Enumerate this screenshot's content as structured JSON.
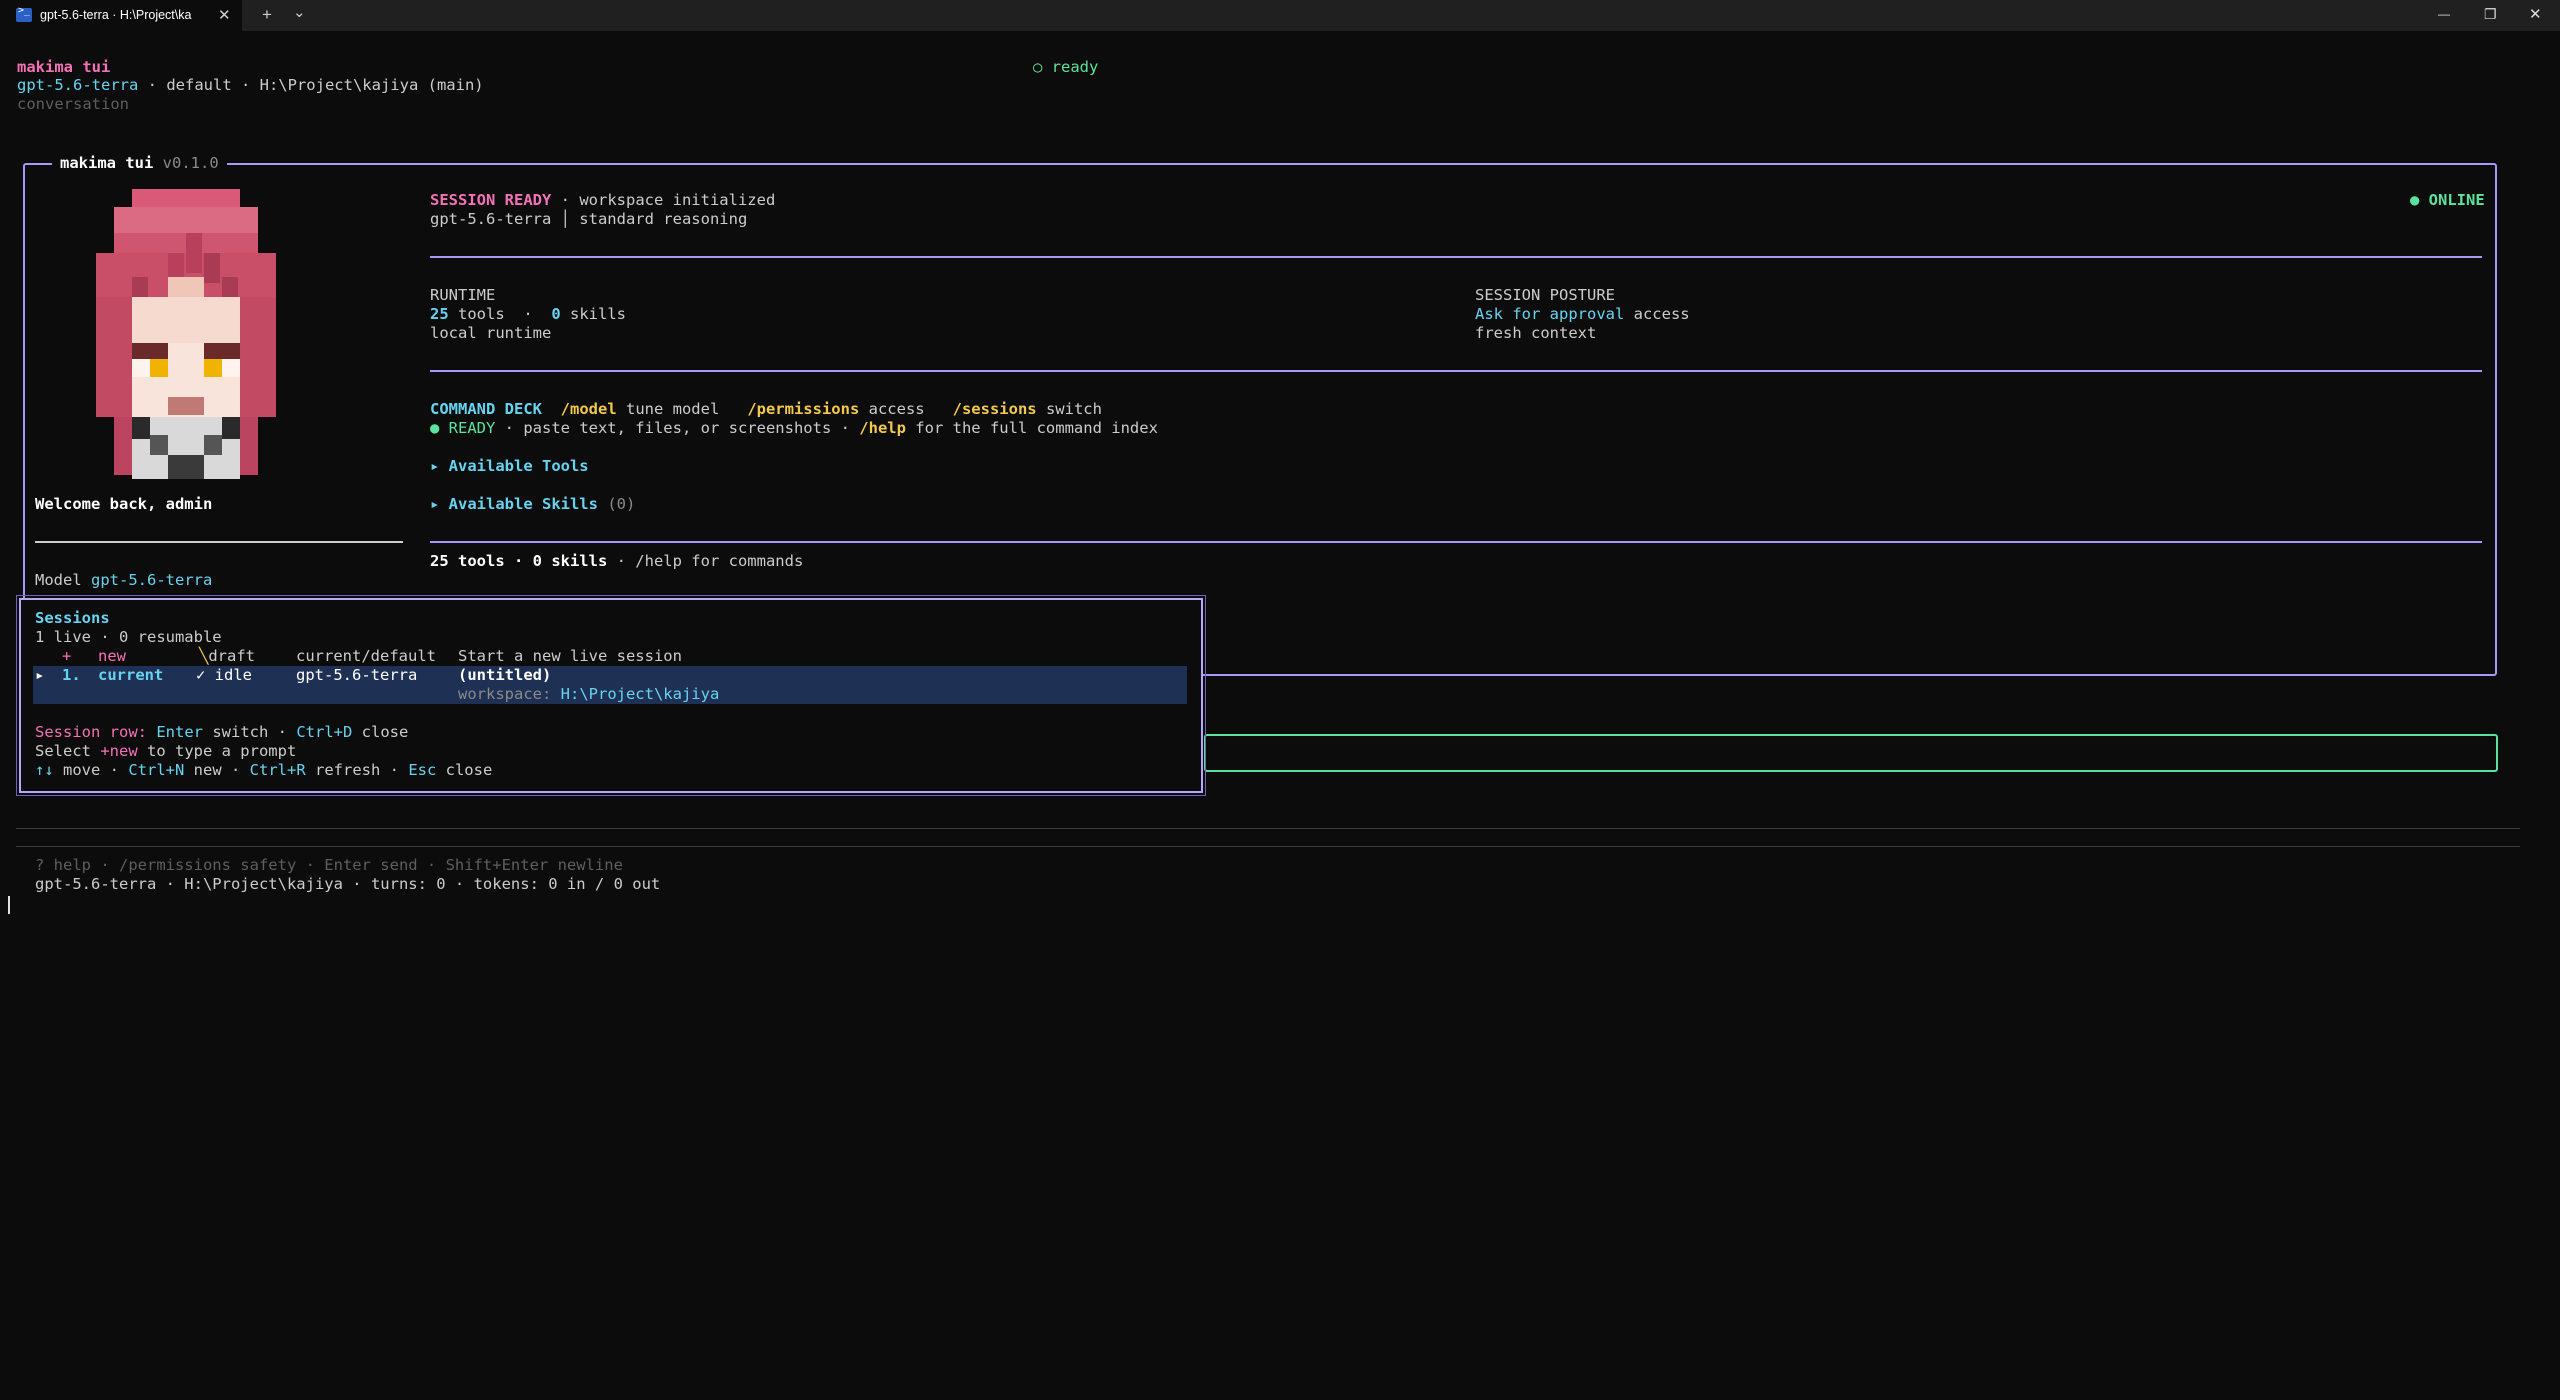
{
  "window": {
    "tab_title": "gpt-5.6-terra · H:\\Project\\ka",
    "tab_close": "✕",
    "new_tab": "+",
    "tab_dropdown": "⌄",
    "minimize": "—",
    "maximize": "❐",
    "close": "✕"
  },
  "header": {
    "app_name": "makima tui",
    "model": "gpt-5.6-terra",
    "profile_path": " · default · H:\\Project\\kajiya (main)",
    "view": "conversation",
    "status": "○ ready"
  },
  "banner": {
    "legend_name": "makima tui",
    "legend_version": "v0.1.0",
    "welcome": "Welcome back, admin",
    "model_label": "Model",
    "model_value": "gpt-5.6-terra",
    "session_ready": "SESSION READY",
    "workspace_text": " · workspace initialized",
    "model_line": "gpt-5.6-terra │ standard reasoning",
    "online": "● ONLINE",
    "runtime_title": "RUNTIME",
    "tools_count": "25",
    "tools_label": " tools  ·  ",
    "skills_count": "0",
    "skills_label": " skills",
    "runtime_mode": "local runtime",
    "posture_title": "SESSION POSTURE",
    "approval": "Ask for approval",
    "approval_suffix": " access",
    "context": "fresh context",
    "deck_title": "COMMAND DECK",
    "cmd_model": "/model",
    "cmd_model_desc": " tune model   ",
    "cmd_permissions": "/permissions",
    "cmd_permissions_desc": " access   ",
    "cmd_sessions": "/sessions",
    "cmd_sessions_desc": " switch",
    "ready_label": "● READY",
    "ready_text": " · paste text, files, or screenshots · ",
    "help_cmd": "/help",
    "help_text": " for the full command index",
    "tools_section": "▸ Available Tools",
    "skills_section": "▸ Available Skills",
    "skills_section_count": " (0)",
    "summary_bold": "25 tools · 0 skills",
    "summary_rest": " · /help for commands"
  },
  "sessions": {
    "title": "Sessions",
    "counts": "1 live · 0 resumable",
    "new_plus": "+",
    "new_label": "new",
    "new_status": "╲draft",
    "new_model": "current/default",
    "new_desc": "Start a new live session",
    "row_arrow": "▸",
    "row_index": "1.",
    "row_name": "current",
    "row_status": "✓ idle",
    "row_model": "gpt-5.6-terra",
    "row_title": "(untitled)",
    "row_ws_label": "workspace: ",
    "row_ws_value": "H:\\Project\\kajiya",
    "hint_row_label": "Session row:",
    "hint_enter": "Enter",
    "hint_switch": " switch · ",
    "hint_ctrl_d": "Ctrl+D",
    "hint_close": " close",
    "select_pre": "Select ",
    "select_key": "+new",
    "select_post": " to type a prompt",
    "nav_arrows": "↑↓",
    "nav_move": " move · ",
    "nav_ctrl_n": "Ctrl+N",
    "nav_new": " new · ",
    "nav_ctrl_r": "Ctrl+R",
    "nav_refresh": " refresh · ",
    "nav_esc": "Esc",
    "nav_close": " close"
  },
  "footer": {
    "hints": "? help · /permissions safety · Enter send · Shift+Enter newline",
    "status": "gpt-5.6-terra · H:\\Project\\kajiya · turns: 0 · tokens: 0 in / 0 out"
  },
  "colors": {
    "background": "#0c0c0c",
    "accent_purple": "#a898f8",
    "pink": "#f472b6",
    "cyan": "#67d3f0",
    "green": "#5be39d",
    "yellow": "#f2c94c",
    "selection": "#1e3154"
  }
}
